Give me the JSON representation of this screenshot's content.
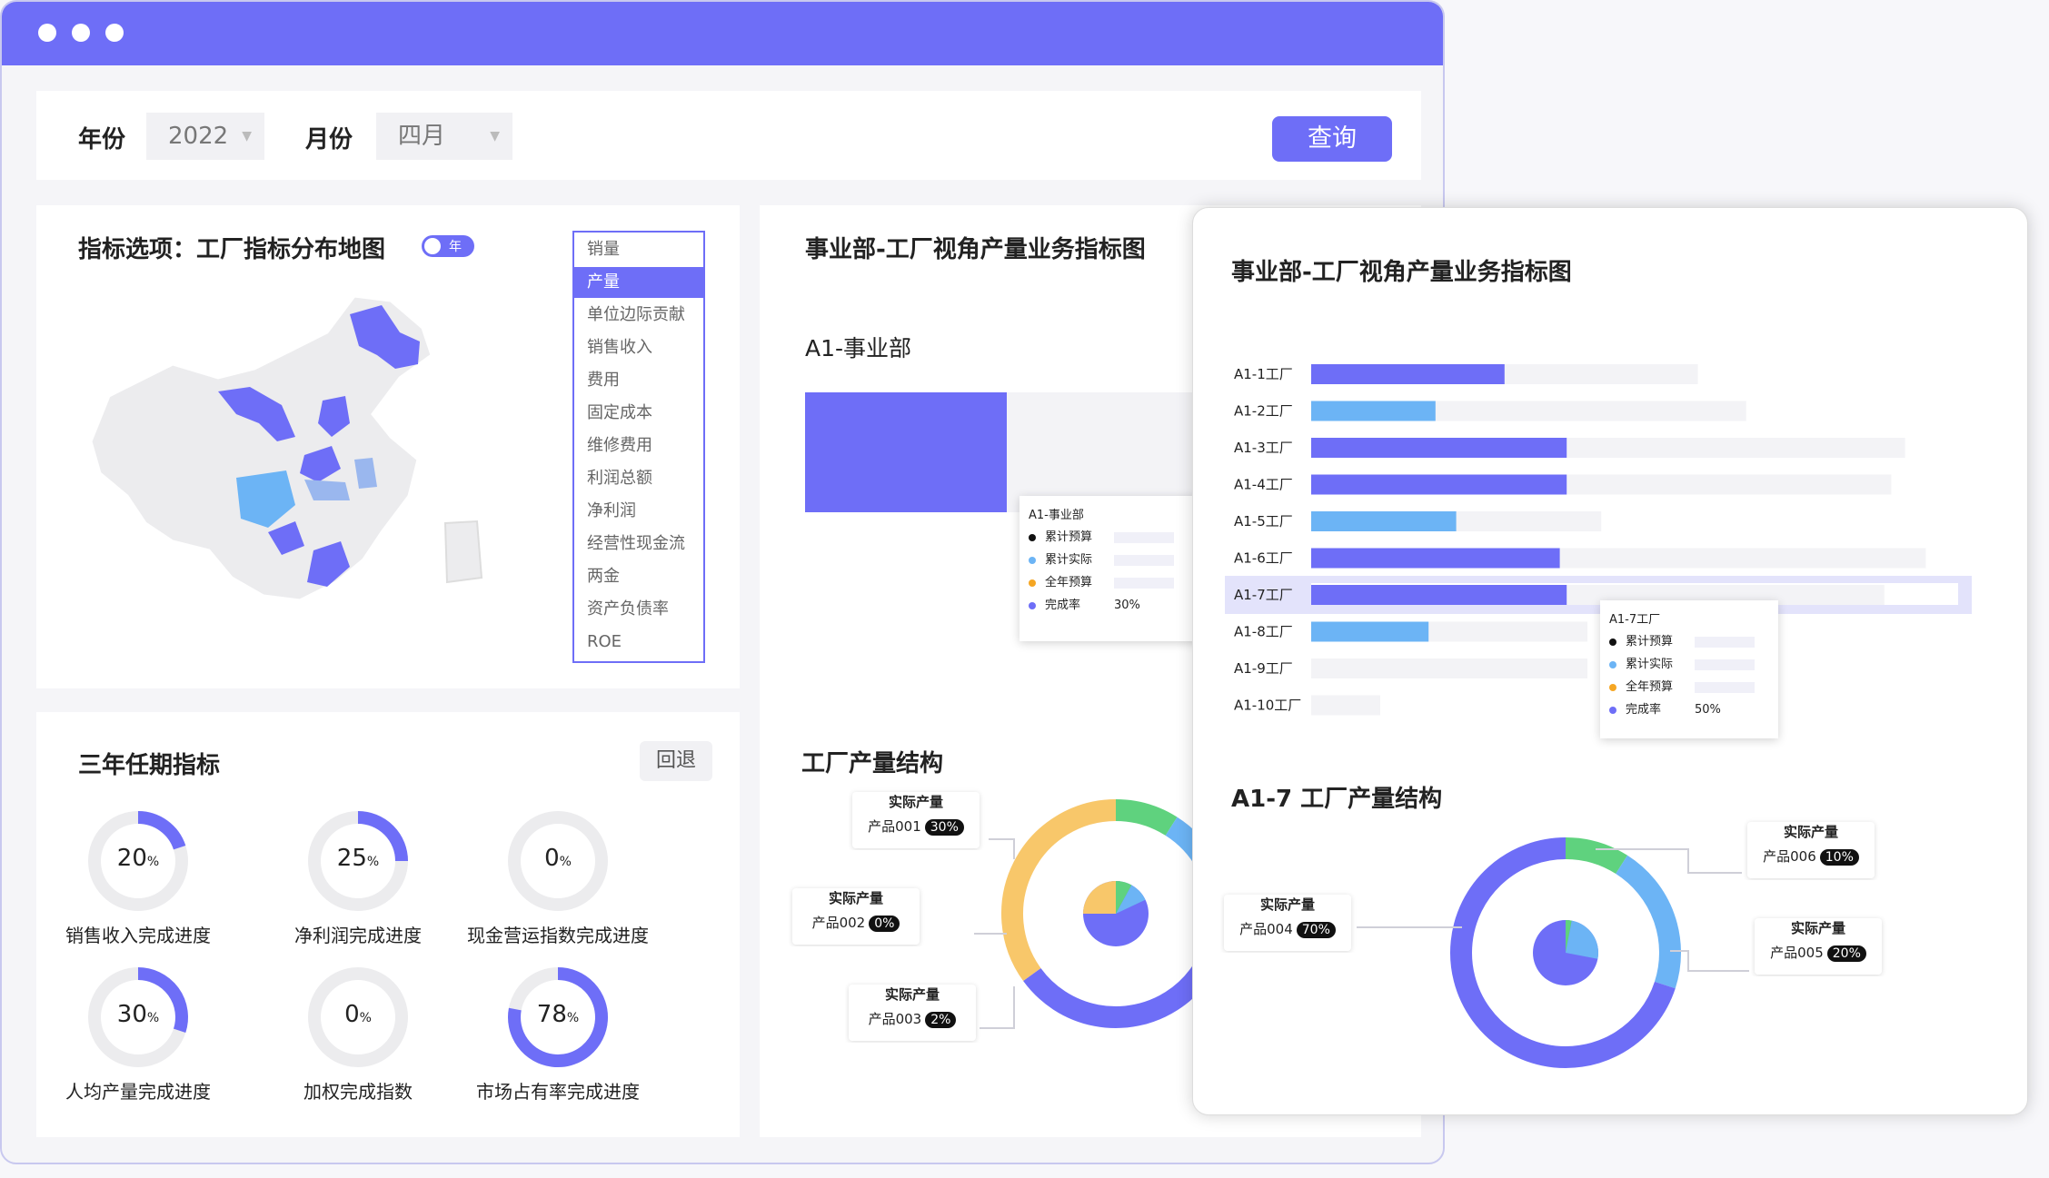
{
  "filters": {
    "year_label": "年份",
    "year_value": "2022",
    "month_label": "月份",
    "month_value": "四月",
    "query_button": "查询"
  },
  "map_panel": {
    "title": "指标选项：工厂指标分布地图",
    "toggle_label": "年",
    "indicator_options": [
      "销量",
      "产量",
      "单位边际贡献",
      "销售收入",
      "费用",
      "固定成本",
      "维修费用",
      "利润总额",
      "净利润",
      "经营性现金流",
      "两金",
      "资产负债率",
      "ROE"
    ],
    "selected_option": "产量"
  },
  "three_year": {
    "title": "三年任期指标",
    "back_button": "回退",
    "rings": [
      {
        "value": "20",
        "unit": "%",
        "fraction": 0.2,
        "label": "销售收入完成进度"
      },
      {
        "value": "25",
        "unit": "%",
        "fraction": 0.25,
        "label": "净利润完成进度"
      },
      {
        "value": "0",
        "unit": "%",
        "fraction": 0.0,
        "label": "现金营运指数完成进度"
      },
      {
        "value": "30",
        "unit": "%",
        "fraction": 0.3,
        "label": "人均产量完成进度"
      },
      {
        "value": "0",
        "unit": "%",
        "fraction": 0.0,
        "label": "加权完成指数"
      },
      {
        "value": "78",
        "unit": "%",
        "fraction": 0.78,
        "label": "市场占有率完成进度"
      }
    ]
  },
  "business_panel": {
    "title": "事业部-工厂视角产量业务指标图",
    "division_label": "A1-事业部",
    "tooltip": {
      "title": "A1-事业部",
      "rows": [
        {
          "label": "累计预算",
          "value": "",
          "color": "#111111"
        },
        {
          "label": "累计实际",
          "value": "",
          "color": "#6cb4f5"
        },
        {
          "label": "全年预算",
          "value": "",
          "color": "#f5a623"
        },
        {
          "label": "完成率",
          "value": "30%",
          "color": "#6e6ef7"
        }
      ]
    },
    "structure_title": "工厂产量结构",
    "structure_cards": [
      {
        "title": "实际产量",
        "product": "产品001",
        "pct": "30%"
      },
      {
        "title": "实际产量",
        "product": "产品002",
        "pct": "0%"
      },
      {
        "title": "实际产量",
        "product": "产品003",
        "pct": "2%"
      }
    ]
  },
  "popup": {
    "title": "事业部-工厂视角产量业务指标图",
    "chart_data": {
      "type": "bar",
      "orientation": "horizontal",
      "categories": [
        "A1-1工厂",
        "A1-2工厂",
        "A1-3工厂",
        "A1-4工厂",
        "A1-5工厂",
        "A1-6工厂",
        "A1-7工厂",
        "A1-8工厂",
        "A1-9工厂",
        "A1-10工厂"
      ],
      "series": [
        {
          "values": [
            0.28,
            0.18,
            0.37,
            0.37,
            0.21,
            0.36,
            0.37,
            0.17,
            0,
            0
          ]
        }
      ],
      "background_values": [
        0.56,
        0.63,
        0.86,
        0.84,
        0.42,
        0.89,
        0.83,
        0.4,
        0.4,
        0.1
      ],
      "highlight": "A1-7工厂",
      "colors": [
        "#6e6ef7",
        "#6cb4f5"
      ]
    },
    "tooltip": {
      "title": "A1-7工厂",
      "rows": [
        {
          "label": "累计预算",
          "value": "",
          "color": "#111111"
        },
        {
          "label": "累计实际",
          "value": "",
          "color": "#6cb4f5"
        },
        {
          "label": "全年预算",
          "value": "",
          "color": "#f5a623"
        },
        {
          "label": "完成率",
          "value": "50%",
          "color": "#6e6ef7"
        }
      ]
    },
    "structure_title": "A1-7 工厂产量结构",
    "structure_cards": [
      {
        "title": "实际产量",
        "product": "产品004",
        "pct": "70%"
      },
      {
        "title": "实际产量",
        "product": "产品006",
        "pct": "10%"
      },
      {
        "title": "实际产量",
        "product": "产品005",
        "pct": "20%"
      }
    ]
  },
  "colors": {
    "accent": "#6e6ef7",
    "light_blue": "#6cb4f5",
    "green": "#5fd27e",
    "orange": "#f8c76a"
  }
}
